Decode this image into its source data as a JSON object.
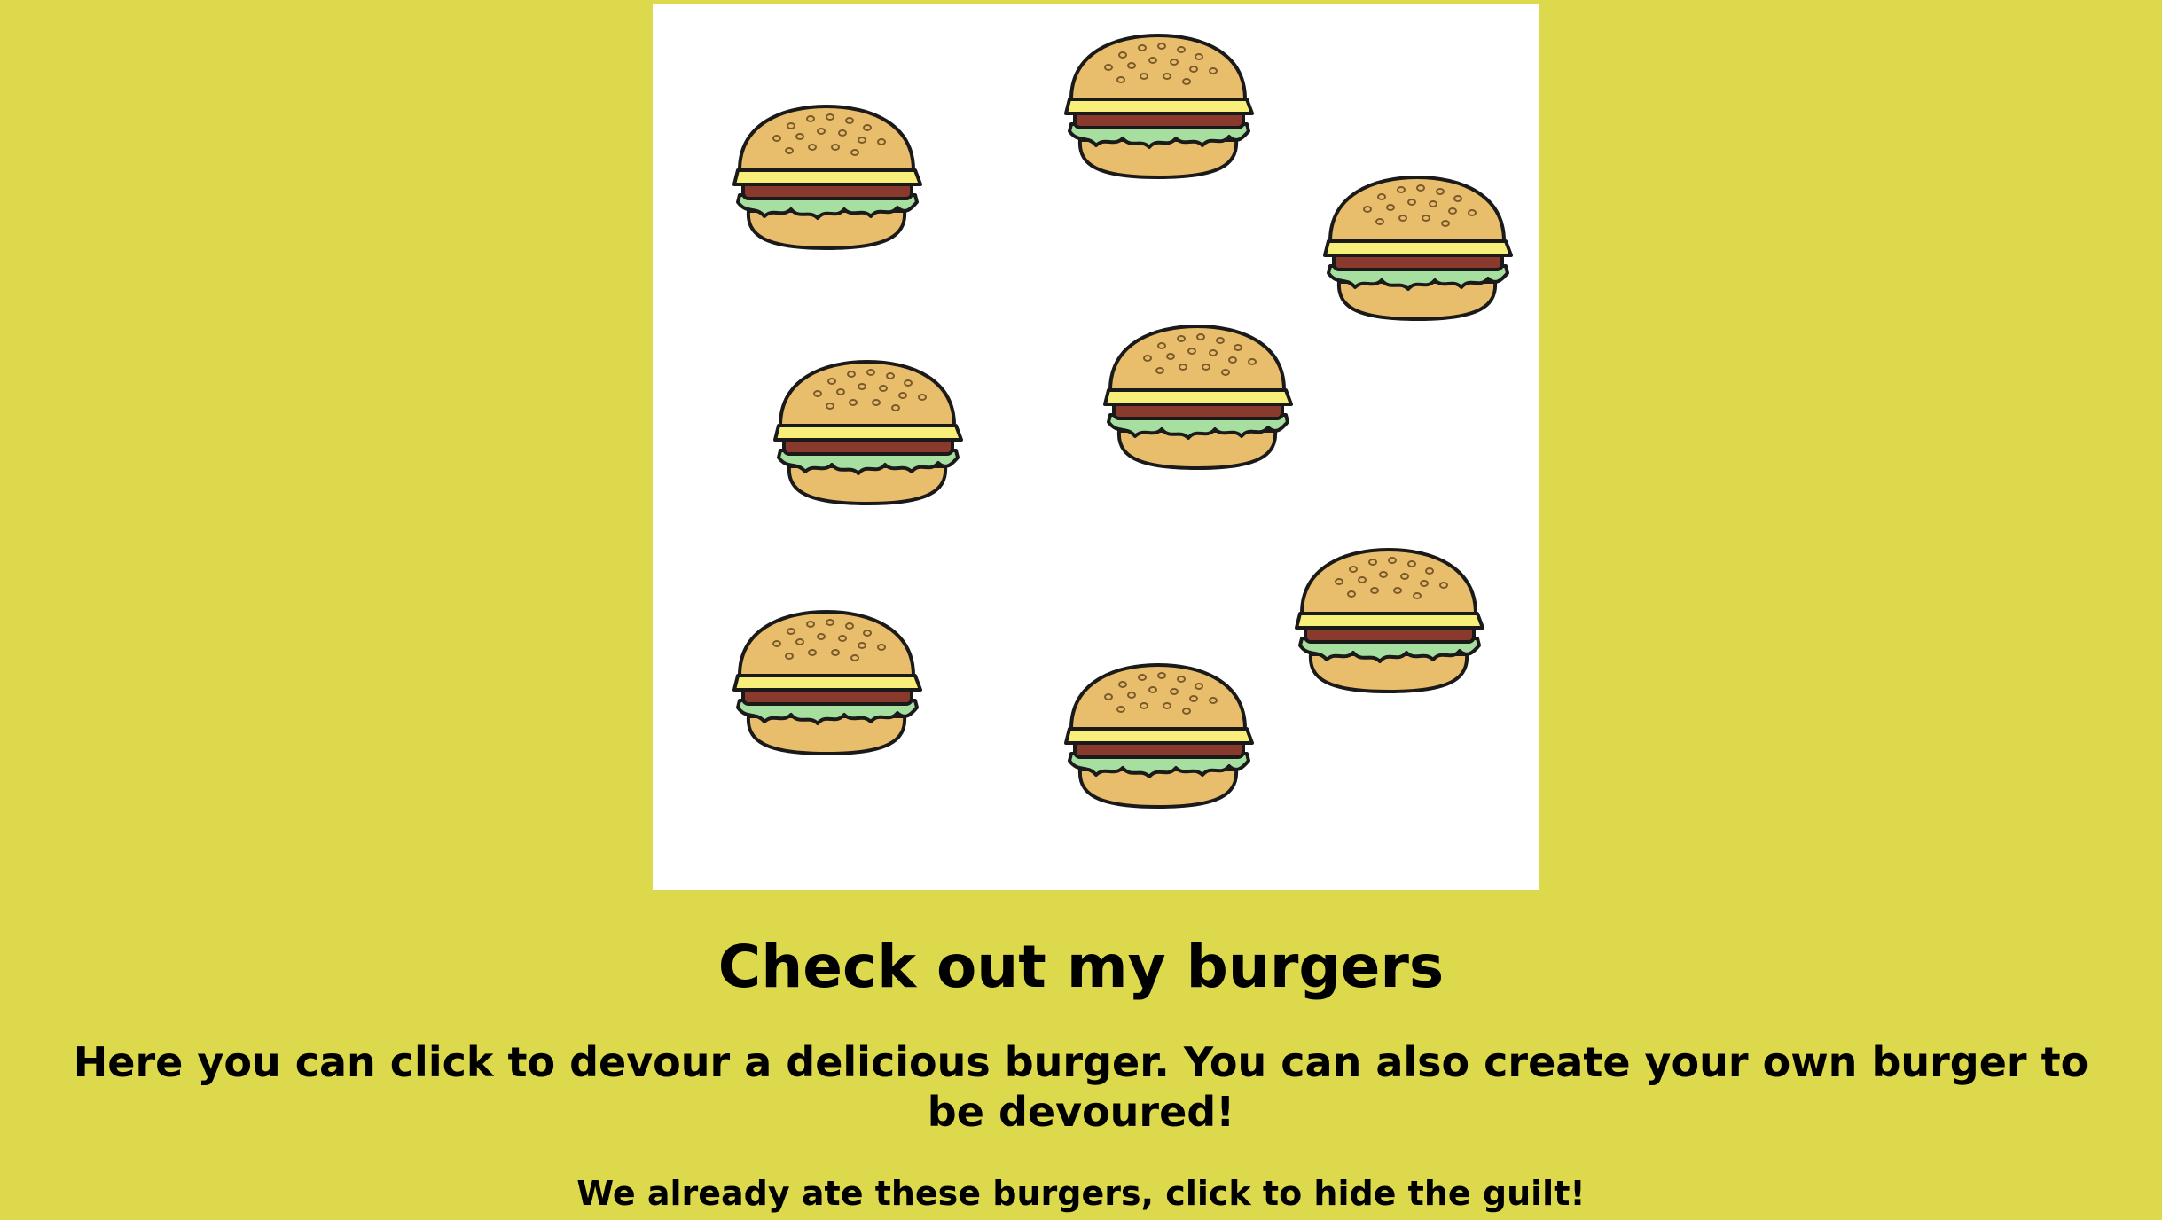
{
  "hero": {
    "icon": "burger-icon",
    "burger_count": 8
  },
  "colors": {
    "background": "#dcd94c",
    "hero_background": "#ffffff",
    "bun": "#e8bd6c",
    "cheese": "#f7ef7a",
    "patty": "#8a3a2c",
    "lettuce": "#a6dfa0",
    "outline": "#1a1a1a"
  },
  "header": {
    "title": "Check out my burgers",
    "subtitle": "Here you can click to devour a delicious burger. You can also create your own burger to be devoured!"
  },
  "devoured": {
    "heading": "We already ate these burgers, click to hide the guilt!"
  }
}
